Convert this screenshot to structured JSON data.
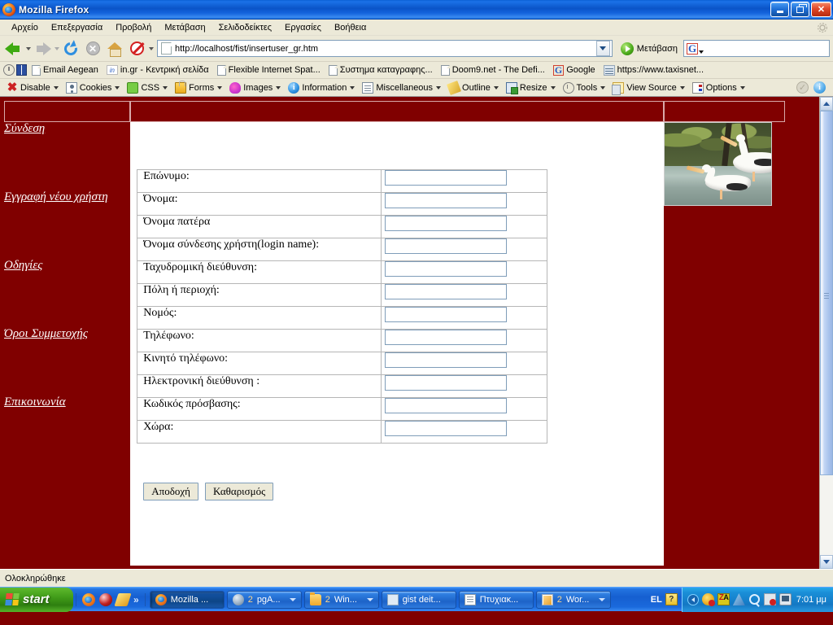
{
  "window": {
    "title": "Mozilla Firefox",
    "icon": "firefox-icon",
    "minimize_label": "Minimize",
    "restore_label": "Restore",
    "close_label": "Close"
  },
  "menubar": {
    "items": [
      {
        "label": "Αρχείο",
        "name": "menu-file"
      },
      {
        "label": "Επεξεργασία",
        "name": "menu-edit"
      },
      {
        "label": "Προβολή",
        "name": "menu-view"
      },
      {
        "label": "Μετάβαση",
        "name": "menu-go"
      },
      {
        "label": "Σελιδοδείκτες",
        "name": "menu-bookmarks"
      },
      {
        "label": "Εργασίες",
        "name": "menu-tools"
      },
      {
        "label": "Βοήθεια",
        "name": "menu-help"
      }
    ]
  },
  "navbar": {
    "back_label": "Πίσω",
    "forward_label": "Μπροστά",
    "reload_label": "Ανανέωση",
    "stop_label": "Διακοπή",
    "home_label": "Αρχική",
    "noscript_label": "NoScript",
    "url": "http://localhost/fist/insertuser_gr.htm",
    "go_label": "Μετάβαση",
    "search_value": "",
    "search_engine": "G"
  },
  "bookmarks": {
    "items": [
      {
        "label": "Email Aegean",
        "icon": "document-icon"
      },
      {
        "label": "in.gr - Κεντρική σελίδα",
        "icon": "ingr-icon"
      },
      {
        "label": "Flexible Internet Spat...",
        "icon": "document-icon"
      },
      {
        "label": "Συστημα καταγραφης...",
        "icon": "document-icon"
      },
      {
        "label": "Doom9.net - The Defi...",
        "icon": "document-icon"
      },
      {
        "label": "Google",
        "icon": "google-icon"
      },
      {
        "label": "https://www.taxisnet...",
        "icon": "taxisnet-icon"
      }
    ]
  },
  "devtoolbar": {
    "items": [
      {
        "label": "Disable",
        "icon": "red-x-icon"
      },
      {
        "label": "Cookies",
        "icon": "cookie-icon"
      },
      {
        "label": "CSS",
        "icon": "css-puzzle-icon"
      },
      {
        "label": "Forms",
        "icon": "lock-icon"
      },
      {
        "label": "Images",
        "icon": "palette-icon"
      },
      {
        "label": "Information",
        "icon": "info-icon"
      },
      {
        "label": "Miscellaneous",
        "icon": "list-icon"
      },
      {
        "label": "Outline",
        "icon": "pencil-icon"
      },
      {
        "label": "Resize",
        "icon": "resize-icon"
      },
      {
        "label": "Tools",
        "icon": "clock-icon"
      },
      {
        "label": "View Source",
        "icon": "clipboard-icon"
      },
      {
        "label": "Options",
        "icon": "options-icon"
      }
    ]
  },
  "sidebar": {
    "links": [
      {
        "label": "Σύνδεση",
        "name": "sidebar-link-login"
      },
      {
        "label": "Εγγραφή νέου χρήστη",
        "name": "sidebar-link-register"
      },
      {
        "label": "Οδηγίες",
        "name": "sidebar-link-instructions"
      },
      {
        "label": "Όροι Συμμετοχής",
        "name": "sidebar-link-terms"
      },
      {
        "label": "Επικοινωνία",
        "name": "sidebar-link-contact"
      }
    ]
  },
  "form": {
    "fields": [
      {
        "label": "Επώνυμο:",
        "value": "",
        "name": "field-surname"
      },
      {
        "label": "Όνομα:",
        "value": "",
        "name": "field-firstname"
      },
      {
        "label": "Όνομα πατέρα",
        "value": "",
        "name": "field-fathername"
      },
      {
        "label": "Όνομα σύνδεσης χρήστη(login name):",
        "value": "",
        "name": "field-loginname"
      },
      {
        "label": "Ταχυδρομική διεύθυνση:",
        "value": "",
        "name": "field-address"
      },
      {
        "label": "Πόλη ή περιοχή:",
        "value": "",
        "name": "field-city"
      },
      {
        "label": "Νομός:",
        "value": "",
        "name": "field-prefecture"
      },
      {
        "label": "Τηλέφωνο:",
        "value": "",
        "name": "field-phone"
      },
      {
        "label": "Κινητό τηλέφωνο:",
        "value": "",
        "name": "field-mobile"
      },
      {
        "label": "Ηλεκτρονική διεύθυνση :",
        "value": "",
        "name": "field-email"
      },
      {
        "label": "Κωδικός πρόσβασης:",
        "value": "",
        "name": "field-password"
      },
      {
        "label": "Χώρα:",
        "value": "",
        "name": "field-country"
      }
    ],
    "submit_label": "Αποδοχή",
    "reset_label": "Καθαρισμός"
  },
  "sideimage": {
    "alt": "pelicans-photo"
  },
  "statusbar": {
    "text": "Ολοκληρώθηκε"
  },
  "taskbar": {
    "start_label": "start",
    "quicklaunch_overflow": "»",
    "tasks": [
      {
        "label": "Mozilla ...",
        "icon": "firefox-icon",
        "active": true,
        "count": "",
        "caret": false
      },
      {
        "label": "pgA...",
        "icon": "postgres-icon",
        "active": false,
        "count": "2",
        "caret": true
      },
      {
        "label": "Win...",
        "icon": "folder-icon",
        "active": false,
        "count": "2",
        "caret": true
      },
      {
        "label": "gist deit...",
        "icon": "document-icon",
        "active": false,
        "count": "",
        "caret": false
      },
      {
        "label": "Πτυχιακ...",
        "icon": "note-icon",
        "active": false,
        "count": "",
        "caret": false
      },
      {
        "label": "Wor...",
        "icon": "word-icon",
        "active": false,
        "count": "2",
        "caret": true
      }
    ],
    "language": "EL",
    "help_label": "?",
    "clock": "7:01 μμ"
  },
  "colors": {
    "page_background": "#800000",
    "content_background": "#ffffff",
    "link_color": "#ffffff",
    "titlebar_blue": "#0a54c8",
    "chrome_beige": "#ece9d8",
    "input_border": "#7f9db9"
  }
}
